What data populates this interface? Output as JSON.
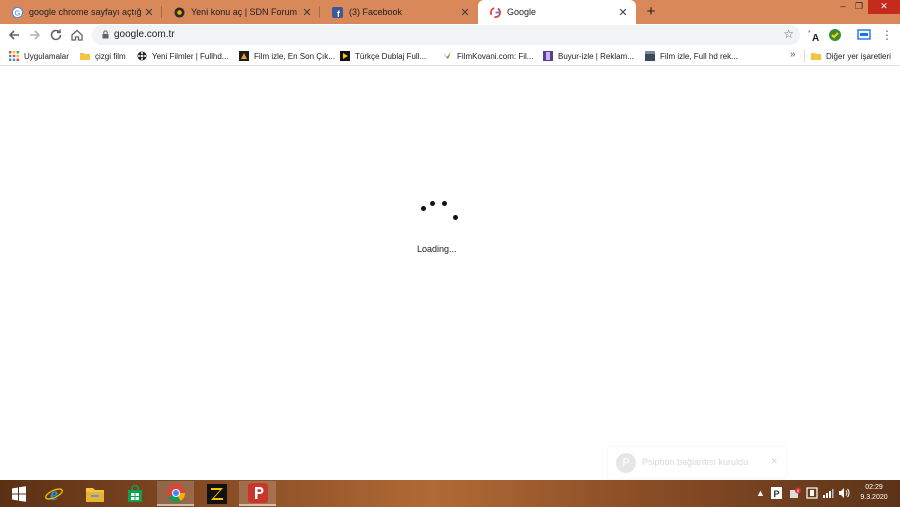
{
  "tabs": [
    {
      "title": "google chrome sayfayı açtığımda",
      "icon": "google-g-icon"
    },
    {
      "title": "Yeni konu aç | SDN Forum",
      "icon": "sdn-icon"
    },
    {
      "title": "(3) Facebook",
      "icon": "facebook-icon"
    },
    {
      "title": "Google",
      "icon": "google-g-icon",
      "active": true
    }
  ],
  "tab_close_glyph": "✕",
  "new_tab_glyph": "+",
  "window_controls": {
    "minimize": "–",
    "maximize": "❐",
    "close": "✕"
  },
  "address": {
    "url": "google.com.tr"
  },
  "bookmarks": [
    {
      "label": "Uygulamalar",
      "icon": "apps-grid-icon"
    },
    {
      "label": "çizgi film",
      "icon": "folder-icon"
    },
    {
      "label": "Yeni Filmler | Fullhd...",
      "icon": "film-reel-icon"
    },
    {
      "label": "Film izle, En Son Çık...",
      "icon": "film-site-icon"
    },
    {
      "label": "Türkçe Dublaj Full...",
      "icon": "play-icon"
    },
    {
      "label": "FilmKovani.com: Fil...",
      "icon": "bird-icon"
    },
    {
      "label": "Buyur-izle | Reklam...",
      "icon": "film-strip-icon"
    },
    {
      "label": "Film izle, Full hd rek...",
      "icon": "film-clapper-icon"
    }
  ],
  "bookmarks_more": "»",
  "other_bookmarks": {
    "label": "Diğer yer işaretleri",
    "icon": "folder-icon"
  },
  "page": {
    "loading_text": "Loading..."
  },
  "toast": {
    "text": "Psiphon bağlantısı kuruldu",
    "close": "✕",
    "icon_letter": "P"
  },
  "taskbar": {
    "apps": [
      "windows-start-icon",
      "internet-explorer-icon",
      "file-explorer-icon",
      "store-icon",
      "chrome-icon",
      "z-app-icon",
      "psiphon-icon"
    ],
    "tray_up": "▲",
    "time": "02:29",
    "date": "9.3.2020"
  },
  "colors": {
    "tab_strip": "#d9885a",
    "taskbar": "#8e5027",
    "facebook": "#3b5998"
  }
}
